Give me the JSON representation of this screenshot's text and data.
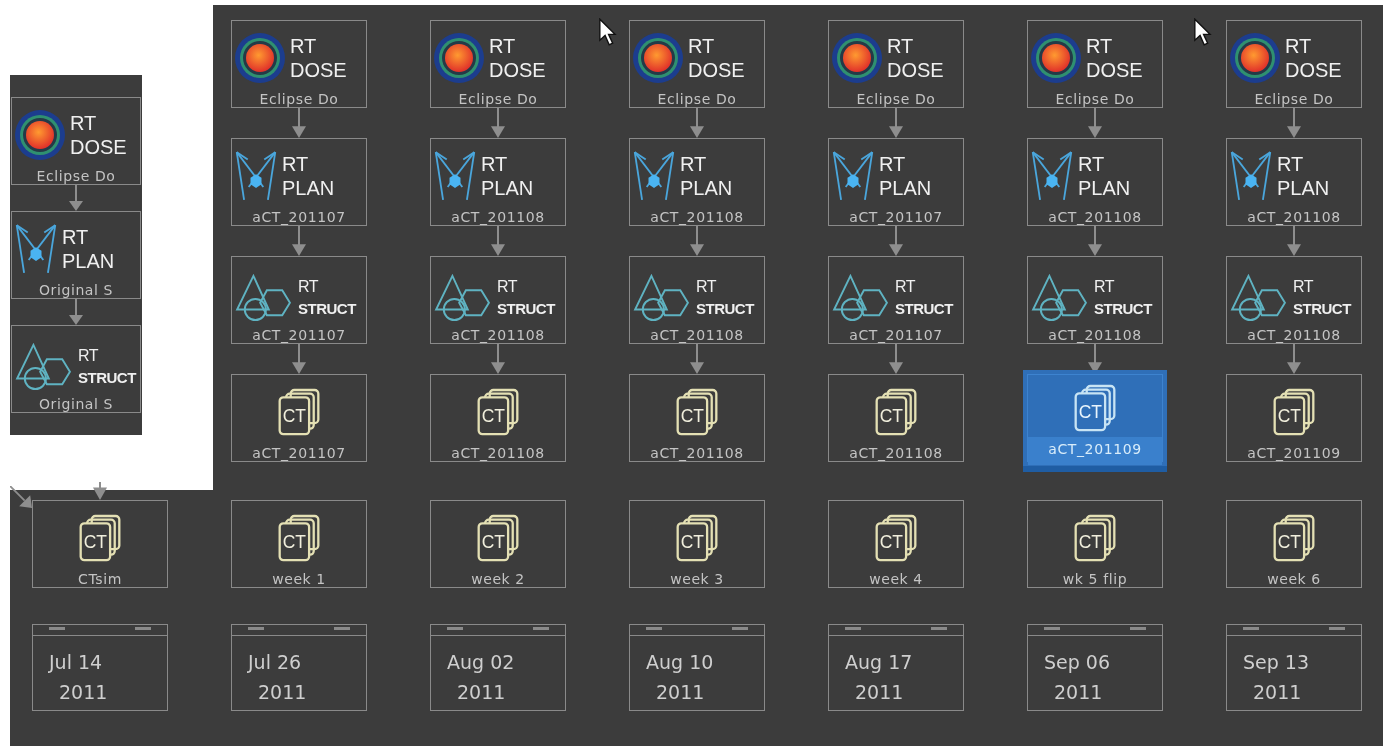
{
  "inset": {
    "nodes": [
      {
        "kind": "dose",
        "type_lines": [
          "RT",
          "DOSE"
        ],
        "label": "Eclipse Do",
        "selected": false
      },
      {
        "kind": "plan",
        "type_lines": [
          "RT",
          "PLAN"
        ],
        "label": "Original S",
        "selected": false
      },
      {
        "kind": "struct",
        "type_lines": [
          "RT",
          "STRUCT"
        ],
        "label": "Original S",
        "selected": false
      }
    ]
  },
  "columns": [
    {
      "series": {
        "icon_text": "CT",
        "label": "CTsim",
        "selected": false
      },
      "date": [
        "Jul 14",
        "2011"
      ]
    },
    {
      "chain": [
        {
          "kind": "dose",
          "type_lines": [
            "RT",
            "DOSE"
          ],
          "label": "Eclipse Do",
          "selected": false
        },
        {
          "kind": "plan",
          "type_lines": [
            "RT",
            "PLAN"
          ],
          "label": "aCT_201107",
          "selected": false
        },
        {
          "kind": "struct",
          "type_lines": [
            "RT",
            "STRUCT"
          ],
          "label": "aCT_201107",
          "selected": false
        },
        {
          "kind": "ct",
          "icon_text": "CT",
          "label": "aCT_201107",
          "selected": false
        }
      ],
      "series": {
        "icon_text": "CT",
        "label": "week 1",
        "selected": false
      },
      "date": [
        "Jul 26",
        "2011"
      ]
    },
    {
      "chain": [
        {
          "kind": "dose",
          "type_lines": [
            "RT",
            "DOSE"
          ],
          "label": "Eclipse Do",
          "selected": false
        },
        {
          "kind": "plan",
          "type_lines": [
            "RT",
            "PLAN"
          ],
          "label": "aCT_201108",
          "selected": false
        },
        {
          "kind": "struct",
          "type_lines": [
            "RT",
            "STRUCT"
          ],
          "label": "aCT_201108",
          "selected": false
        },
        {
          "kind": "ct",
          "icon_text": "CT",
          "label": "aCT_201108",
          "selected": false
        }
      ],
      "series": {
        "icon_text": "CT",
        "label": "week 2",
        "selected": false
      },
      "date": [
        "Aug 02",
        "2011"
      ]
    },
    {
      "chain": [
        {
          "kind": "dose",
          "type_lines": [
            "RT",
            "DOSE"
          ],
          "label": "Eclipse Do",
          "selected": false
        },
        {
          "kind": "plan",
          "type_lines": [
            "RT",
            "PLAN"
          ],
          "label": "aCT_201108",
          "selected": false
        },
        {
          "kind": "struct",
          "type_lines": [
            "RT",
            "STRUCT"
          ],
          "label": "aCT_201108",
          "selected": false
        },
        {
          "kind": "ct",
          "icon_text": "CT",
          "label": "aCT_201108",
          "selected": false
        }
      ],
      "series": {
        "icon_text": "CT",
        "label": "week 3",
        "selected": false
      },
      "date": [
        "Aug 10",
        "2011"
      ]
    },
    {
      "chain": [
        {
          "kind": "dose",
          "type_lines": [
            "RT",
            "DOSE"
          ],
          "label": "Eclipse Do",
          "selected": false
        },
        {
          "kind": "plan",
          "type_lines": [
            "RT",
            "PLAN"
          ],
          "label": "aCT_201107",
          "selected": false
        },
        {
          "kind": "struct",
          "type_lines": [
            "RT",
            "STRUCT"
          ],
          "label": "aCT_201107",
          "selected": false
        },
        {
          "kind": "ct",
          "icon_text": "CT",
          "label": "aCT_201108",
          "selected": false
        }
      ],
      "series": {
        "icon_text": "CT",
        "label": "week 4",
        "selected": false
      },
      "date": [
        "Aug 17",
        "2011"
      ]
    },
    {
      "chain": [
        {
          "kind": "dose",
          "type_lines": [
            "RT",
            "DOSE"
          ],
          "label": "Eclipse Do",
          "selected": false
        },
        {
          "kind": "plan",
          "type_lines": [
            "RT",
            "PLAN"
          ],
          "label": "aCT_201108",
          "selected": false
        },
        {
          "kind": "struct",
          "type_lines": [
            "RT",
            "STRUCT"
          ],
          "label": "aCT_201108",
          "selected": false
        },
        {
          "kind": "ct",
          "icon_text": "CT",
          "label": "aCT_201109",
          "selected": true
        }
      ],
      "series": {
        "icon_text": "CT",
        "label": "wk 5 flip",
        "selected": false
      },
      "date": [
        "Sep 06",
        "2011"
      ]
    },
    {
      "chain": [
        {
          "kind": "dose",
          "type_lines": [
            "RT",
            "DOSE"
          ],
          "label": "Eclipse Do",
          "selected": false
        },
        {
          "kind": "plan",
          "type_lines": [
            "RT",
            "PLAN"
          ],
          "label": "aCT_201108",
          "selected": false
        },
        {
          "kind": "struct",
          "type_lines": [
            "RT",
            "STRUCT"
          ],
          "label": "aCT_201108",
          "selected": false
        },
        {
          "kind": "ct",
          "icon_text": "CT",
          "label": "aCT_201109",
          "selected": false
        }
      ],
      "series": {
        "icon_text": "CT",
        "label": "week 6",
        "selected": false
      },
      "date": [
        "Sep 13",
        "2011"
      ]
    }
  ]
}
